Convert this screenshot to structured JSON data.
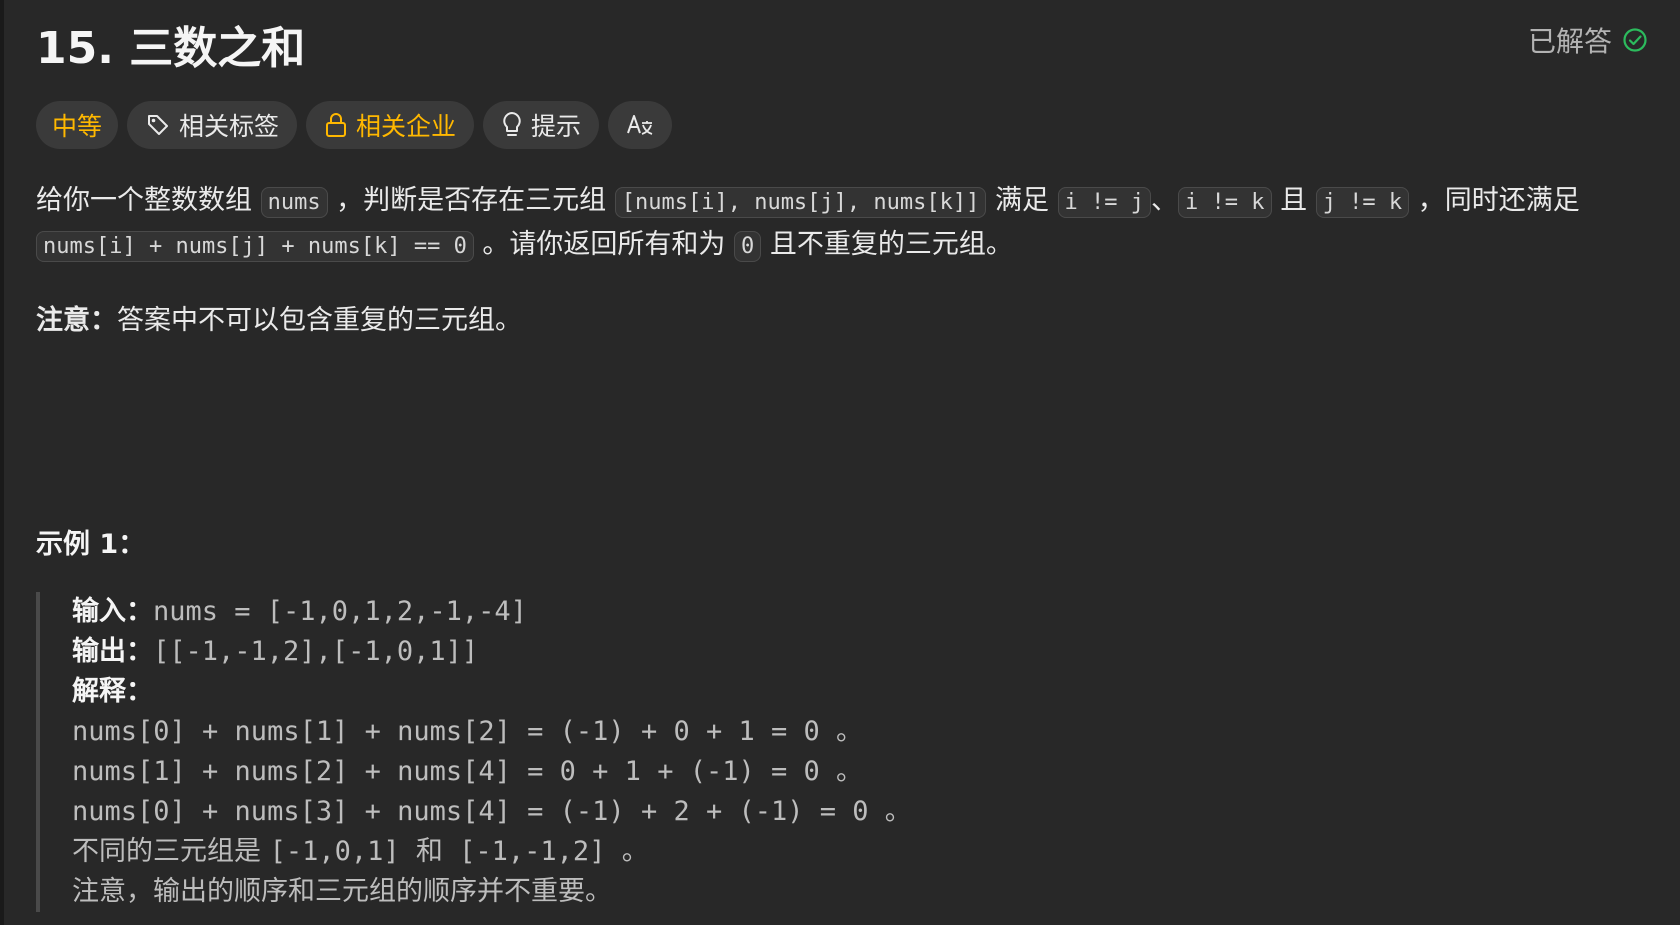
{
  "problem": {
    "title": "15. 三数之和",
    "status": "已解答",
    "colors": {
      "difficulty": "#ffb800",
      "solved": "#2cbb5d"
    }
  },
  "tags": {
    "difficulty": "中等",
    "related_tags": "相关标签",
    "related_companies": "相关企业",
    "hint": "提示",
    "translate_icon": "translate-icon"
  },
  "description": {
    "p1_text1": "给你一个整数数组 ",
    "p1_code1": "nums",
    "p1_text2": " ，判断是否存在三元组 ",
    "p1_code2": "[nums[i], nums[j], nums[k]]",
    "p1_text3": " 满足 ",
    "p1_code3": "i != j",
    "p1_text4": "、",
    "p1_code4": "i != k",
    "p1_text5": " 且 ",
    "p1_code5": "j != k",
    "p1_text6": " ，同时还满足 ",
    "p1_code6": "nums[i] + nums[j] + nums[k] == 0",
    "p1_text7": " 。请你返回所有和为 ",
    "p1_code7": "0",
    "p1_text8": " 且不重复的三元组。",
    "note_label": "注意：",
    "note_text": "答案中不可以包含重复的三元组。"
  },
  "example": {
    "title": "示例 1：",
    "input_label": "输入：",
    "input_value": "nums = [-1,0,1,2,-1,-4]",
    "output_label": "输出：",
    "output_value": "[[-1,-1,2],[-1,0,1]]",
    "explain_label": "解释：",
    "line1": "nums[0] + nums[1] + nums[2] = (-1) + 0 + 1 = 0 。",
    "line2": "nums[1] + nums[2] + nums[4] = 0 + 1 + (-1) = 0 。",
    "line3": "nums[0] + nums[3] + nums[4] = (-1) + 2 + (-1) = 0 。",
    "line4_text": "不同的三元组是 ",
    "line4_code": "[-1,0,1] 和 [-1,-1,2] 。",
    "line5": "注意，输出的顺序和三元组的顺序并不重要。"
  }
}
